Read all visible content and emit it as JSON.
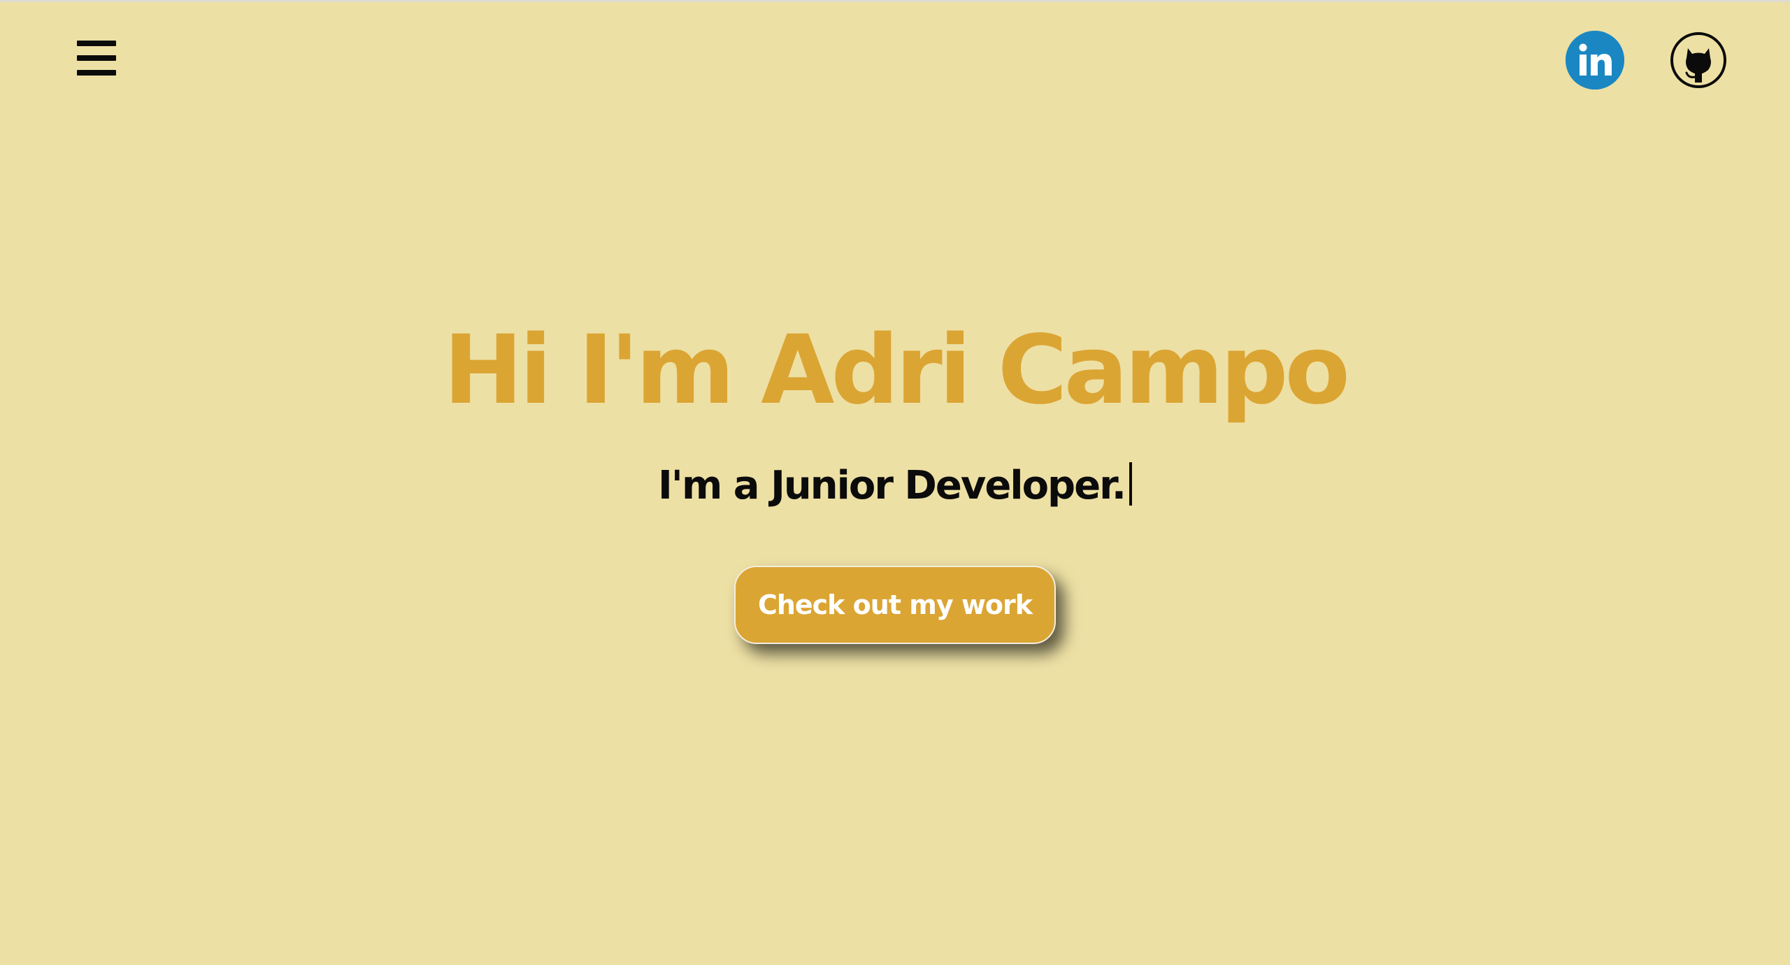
{
  "header": {
    "menu_icon": "hamburger-menu-icon",
    "social_links": [
      {
        "name": "LinkedIn",
        "icon": "linkedin-icon",
        "label": "in",
        "color": "#1a87c3"
      },
      {
        "name": "GitHub",
        "icon": "github-octocat-icon",
        "color": "#0b0b0b"
      }
    ]
  },
  "hero": {
    "title": "Hi I'm Adri Campo",
    "subtitle": "I'm a Junior Developer.",
    "cta_label": "Check out my work"
  },
  "colors": {
    "background": "#ede0a4",
    "accent": "#dba534",
    "text": "#0b0b0b",
    "button_text": "#ffffff"
  }
}
